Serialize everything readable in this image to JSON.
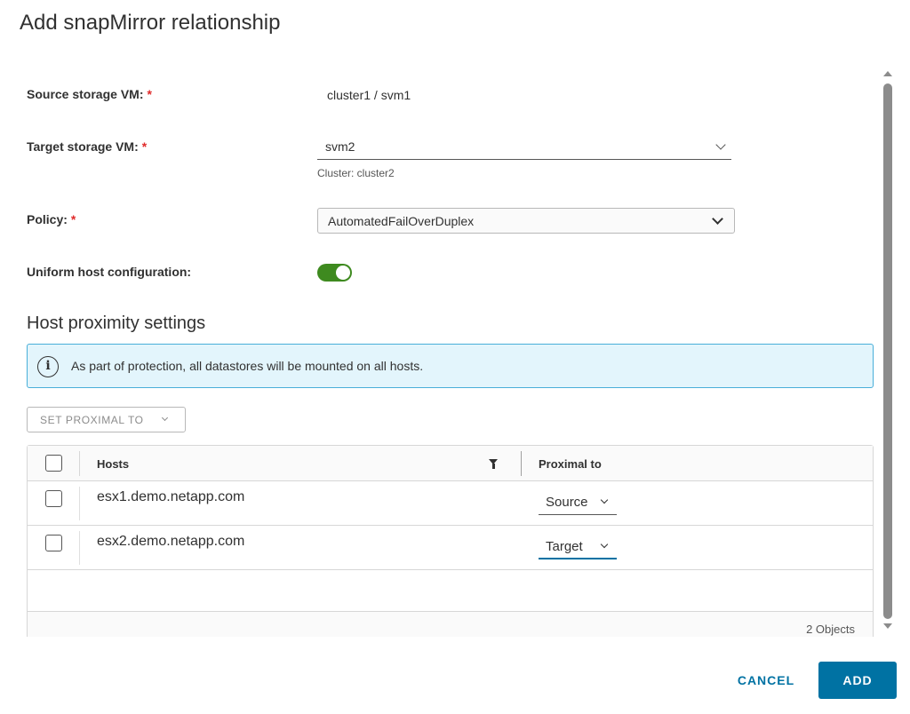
{
  "dialog": {
    "title": "Add snapMirror relationship"
  },
  "form": {
    "source": {
      "label": "Source storage VM:",
      "required_mark": "*",
      "value": "cluster1 / svm1"
    },
    "target": {
      "label": "Target storage VM:",
      "required_mark": "*",
      "value": "svm2",
      "helper": "Cluster: cluster2"
    },
    "policy": {
      "label": "Policy:",
      "required_mark": "*",
      "value": "AutomatedFailOverDuplex"
    },
    "uniform": {
      "label": "Uniform host configuration:",
      "enabled": true
    }
  },
  "host_proximity": {
    "heading": "Host proximity settings",
    "info_message": "As part of protection, all datastores will be mounted on all hosts.",
    "set_proximal_button": "SET PROXIMAL TO",
    "columns": {
      "hosts": "Hosts",
      "proximal_to": "Proximal to"
    },
    "rows": [
      {
        "host": "esx1.demo.netapp.com",
        "proximal": "Source"
      },
      {
        "host": "esx2.demo.netapp.com",
        "proximal": "Target"
      }
    ],
    "footer_count": "2 Objects"
  },
  "footer": {
    "cancel_label": "CANCEL",
    "add_label": "ADD"
  },
  "colors": {
    "accent": "#0072a3",
    "toggle_on": "#3e8a1f",
    "info_bg": "#e3f5fc",
    "info_border": "#49afd9",
    "required": "#e02b2b"
  },
  "icons": {
    "info": "info-circle-icon",
    "filter": "filter-icon",
    "dropdown": "chevron-down-icon"
  }
}
